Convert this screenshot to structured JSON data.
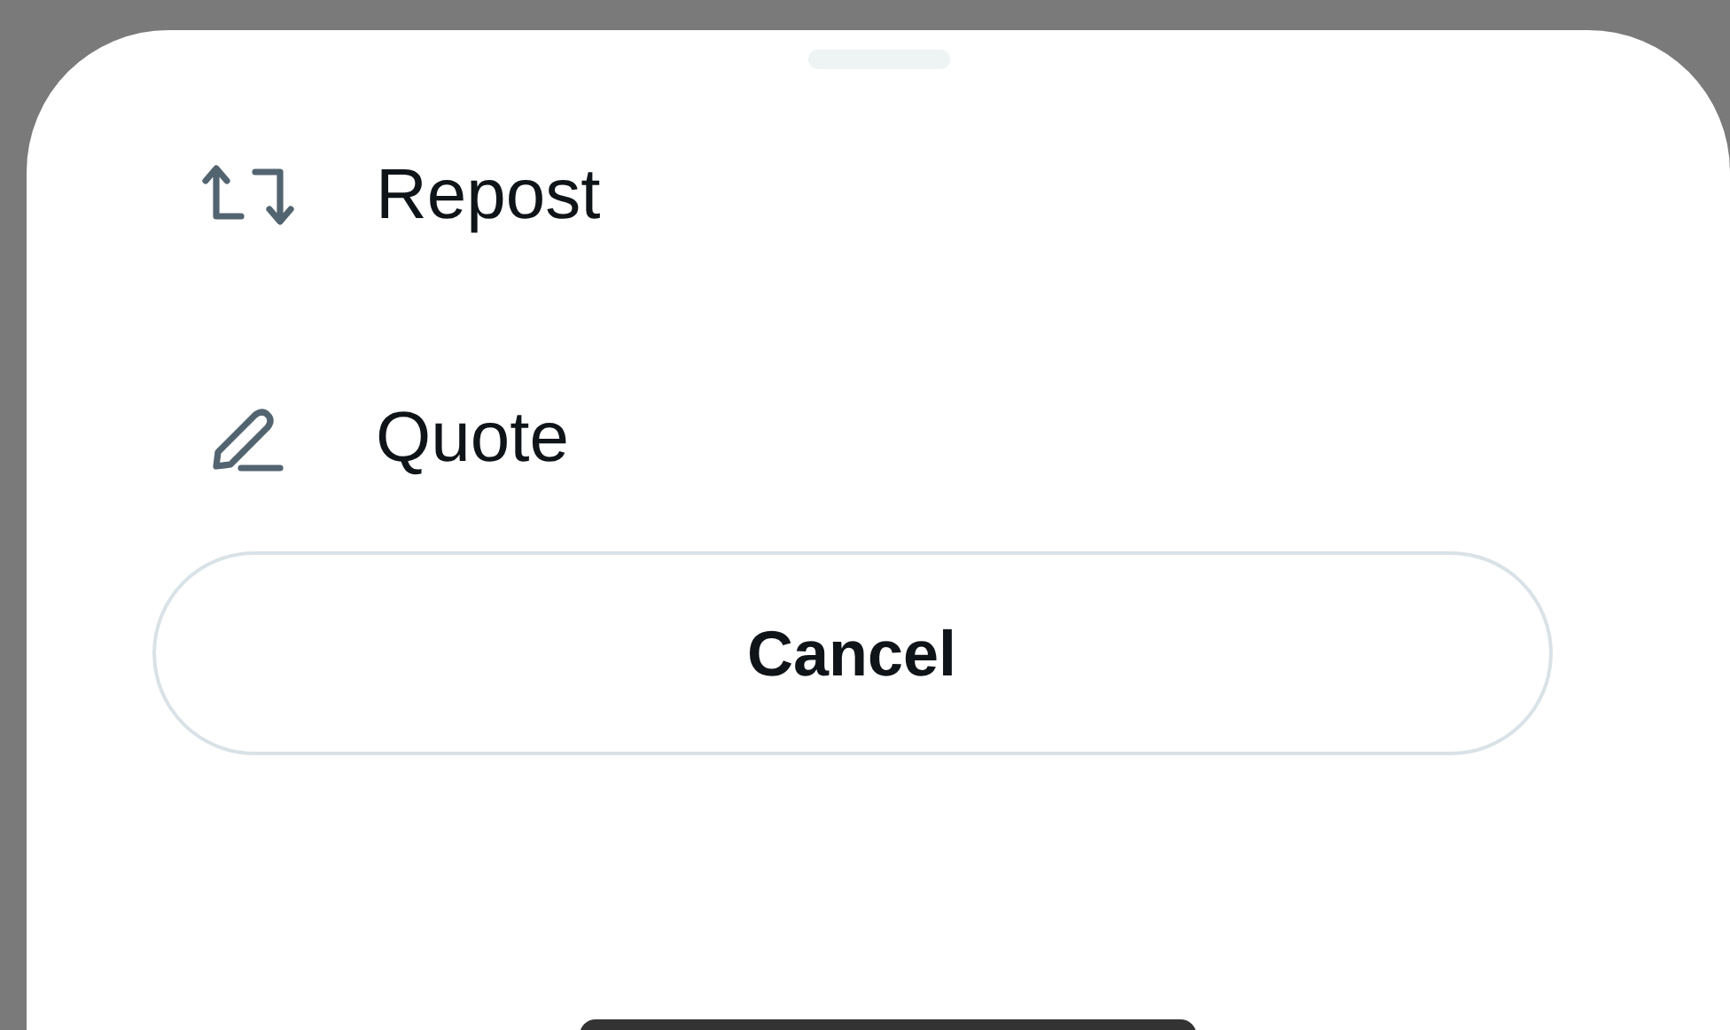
{
  "sheet": {
    "options": [
      {
        "kind": "repost",
        "label": "Repost"
      },
      {
        "kind": "quote",
        "label": "Quote"
      }
    ],
    "cancel_button": "Cancel"
  }
}
